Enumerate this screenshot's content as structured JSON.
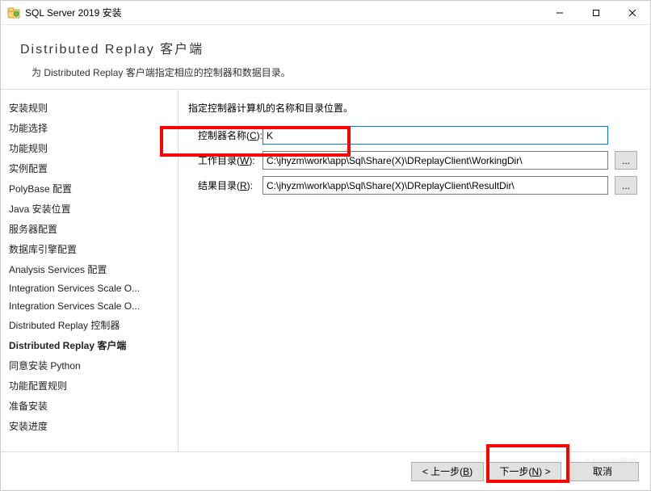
{
  "window": {
    "title": "SQL Server 2019 安装"
  },
  "header": {
    "title": "Distributed  Replay 客户端",
    "description": "为 Distributed Replay 客户端指定相应的控制器和数据目录。"
  },
  "sidebar": {
    "items": [
      {
        "label": "安装规则"
      },
      {
        "label": "功能选择"
      },
      {
        "label": "功能规则"
      },
      {
        "label": "实例配置"
      },
      {
        "label": "PolyBase 配置"
      },
      {
        "label": "Java 安装位置"
      },
      {
        "label": "服务器配置"
      },
      {
        "label": "数据库引擎配置"
      },
      {
        "label": "Analysis Services 配置"
      },
      {
        "label": "Integration Services Scale O..."
      },
      {
        "label": "Integration Services Scale O..."
      },
      {
        "label": "Distributed Replay 控制器"
      },
      {
        "label": "Distributed Replay 客户端",
        "current": true
      },
      {
        "label": "同意安装 Python"
      },
      {
        "label": "功能配置规则"
      },
      {
        "label": "准备安装"
      },
      {
        "label": "安装进度"
      }
    ]
  },
  "content": {
    "description": "指定控制器计算机的名称和目录位置。",
    "controller_label_pre": "控制器名称(",
    "controller_mn": "C",
    "controller_label_post": "):",
    "controller_value": "K",
    "workdir_label_pre": "工作目录(",
    "workdir_mn": "W",
    "workdir_label_post": "):",
    "workdir_value": "C:\\jhyzm\\work\\app\\Sql\\Share(X)\\DReplayClient\\WorkingDir\\",
    "resultdir_label_pre": "结果目录(",
    "resultdir_mn": "R",
    "resultdir_label_post": "):",
    "resultdir_value": "C:\\jhyzm\\work\\app\\Sql\\Share(X)\\DReplayClient\\ResultDir\\",
    "browse": "..."
  },
  "footer": {
    "back_pre": "< 上一步(",
    "back_mn": "B",
    "back_post": ")",
    "next_pre": "下一步(",
    "next_mn": "N",
    "next_post": ") >",
    "cancel": "取消"
  },
  "watermark": "51CTO博客"
}
